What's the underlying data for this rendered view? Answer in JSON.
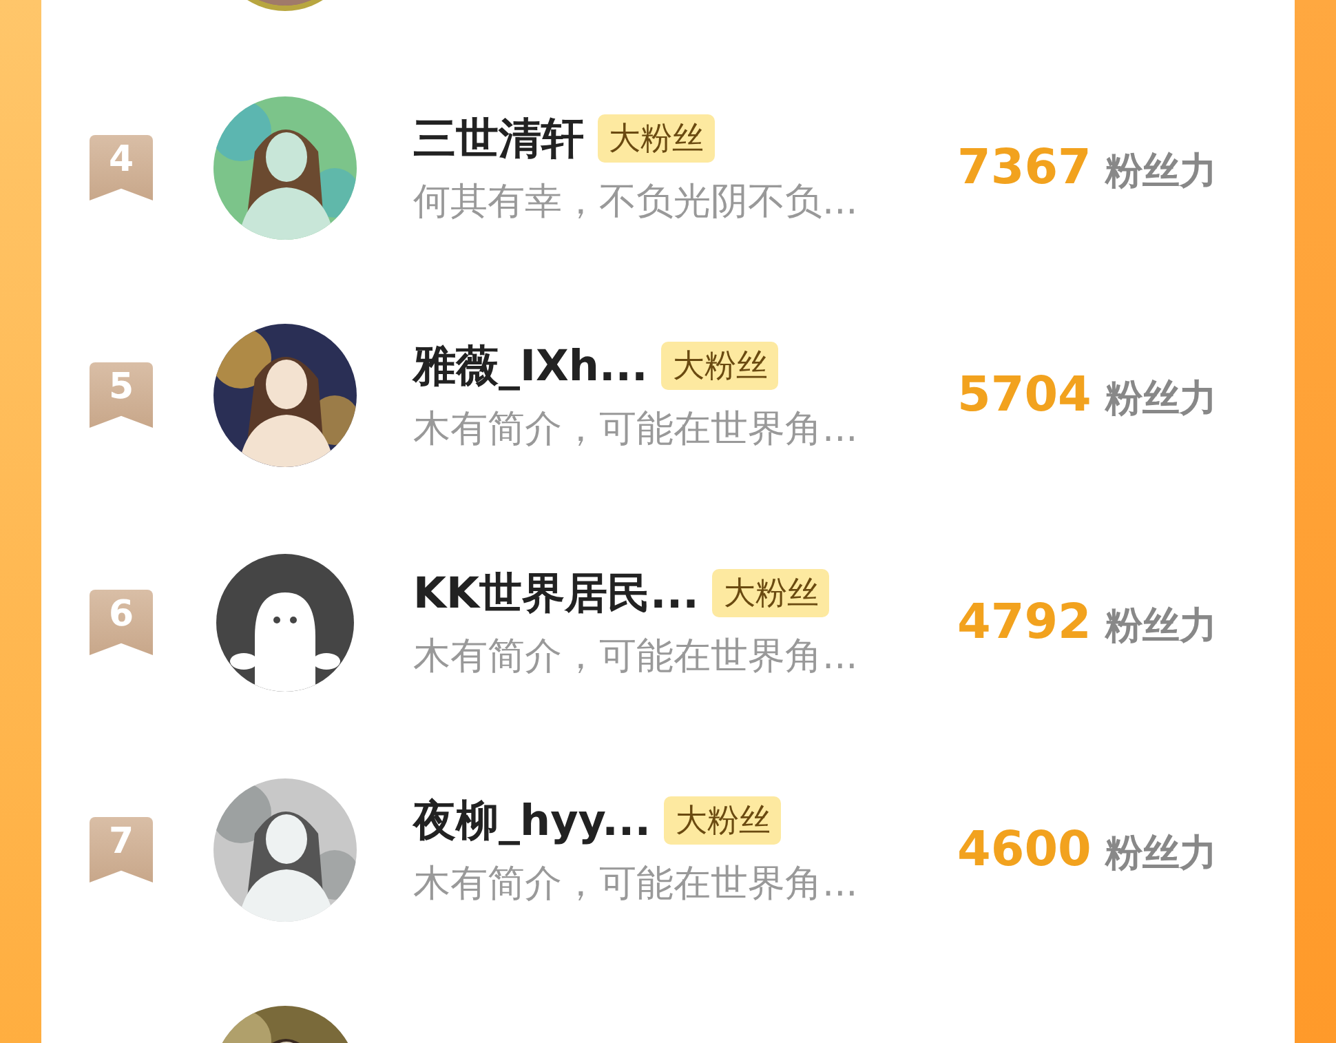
{
  "previous_row": {
    "avatar": {
      "kind": "picture"
    }
  },
  "rows": [
    {
      "rank": "4",
      "avatar": {
        "kind": "picture"
      },
      "name": "三世清轩",
      "badge": "大粉丝",
      "bio": "何其有幸，不负光阴不负...",
      "score": "7367",
      "unit": "粉丝力"
    },
    {
      "rank": "5",
      "avatar": {
        "kind": "picture"
      },
      "name": "雅薇_IXh...",
      "badge": "大粉丝",
      "bio": "木有简介，可能在世界角...",
      "score": "5704",
      "unit": "粉丝力"
    },
    {
      "rank": "6",
      "avatar": {
        "kind": "default"
      },
      "name": "KK世界居民...",
      "badge": "大粉丝",
      "bio": "木有简介，可能在世界角...",
      "score": "4792",
      "unit": "粉丝力"
    },
    {
      "rank": "7",
      "avatar": {
        "kind": "picture"
      },
      "name": "夜柳_hyy...",
      "badge": "大粉丝",
      "bio": "木有简介，可能在世界角...",
      "score": "4600",
      "unit": "粉丝力"
    },
    {
      "avatar": {
        "kind": "picture"
      }
    }
  ]
}
